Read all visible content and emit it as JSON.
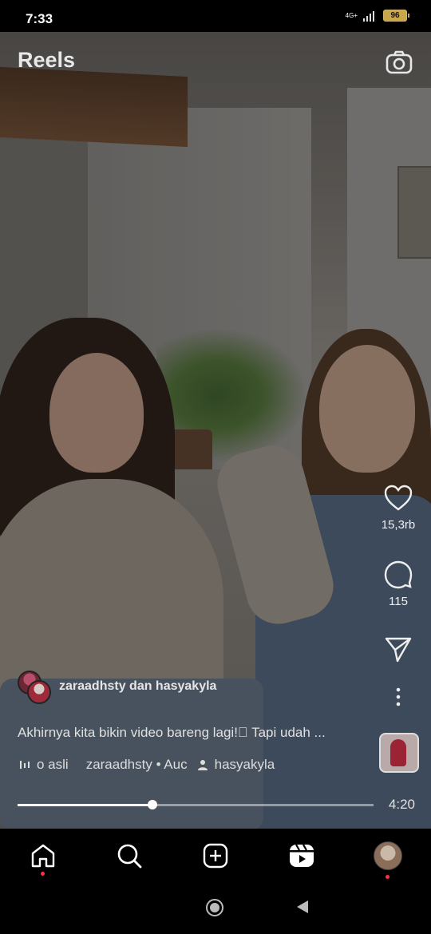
{
  "status_bar": {
    "time": "7:33",
    "network": "4G+",
    "battery": "96"
  },
  "header": {
    "title": "Reels",
    "camera_icon": "camera-icon"
  },
  "actions": {
    "likes": "15,3rb",
    "comments": "115"
  },
  "post": {
    "author": "zaraadhsty dan hasyakyla",
    "caption": "Akhirnya kita bikin video bareng lagi!\u0000 Tapi udah ...",
    "audio": "o asli",
    "audio_artist": "zaraadhsty • Auc",
    "tagged_user": "hasyakyla"
  },
  "player": {
    "progress": 0.38,
    "duration": "4:20"
  },
  "nav": {
    "items": [
      "home-icon",
      "search-icon",
      "create-icon",
      "reels-icon",
      "profile-avatar"
    ]
  },
  "colors": {
    "accent_dot": "#ff3040",
    "battery": "#c9a74a"
  }
}
